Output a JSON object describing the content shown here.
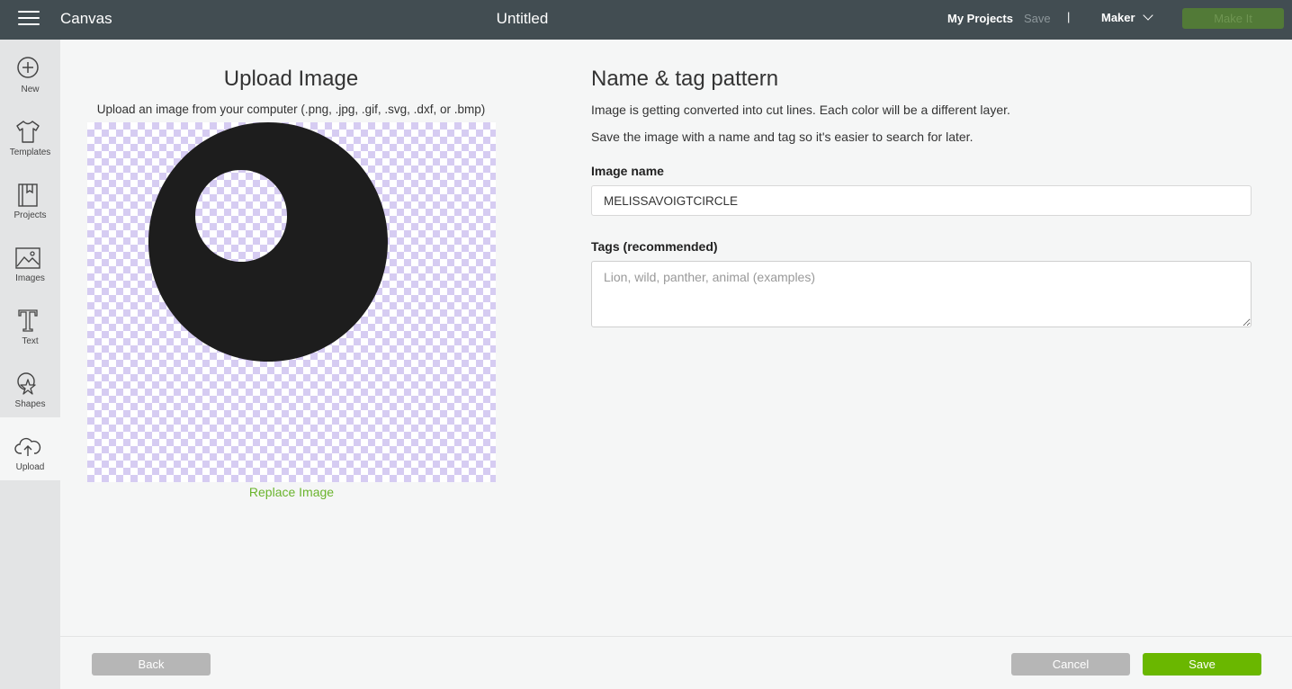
{
  "header": {
    "app_name": "Canvas",
    "doc_title": "Untitled",
    "my_projects": "My Projects",
    "save": "Save",
    "separator": "|",
    "machine": "Maker",
    "make_it": "Make It"
  },
  "sidebar": {
    "items": [
      {
        "label": "New",
        "icon": "plus-circle-icon"
      },
      {
        "label": "Templates",
        "icon": "tshirt-icon"
      },
      {
        "label": "Projects",
        "icon": "notebook-icon"
      },
      {
        "label": "Images",
        "icon": "image-icon"
      },
      {
        "label": "Text",
        "icon": "text-t-icon"
      },
      {
        "label": "Shapes",
        "icon": "shapes-icon"
      },
      {
        "label": "Upload",
        "icon": "cloud-upload-icon",
        "active": true
      }
    ]
  },
  "upload": {
    "title": "Upload Image",
    "description": "Upload an image from your computer (.png, .jpg, .gif, .svg, .dxf, or .bmp)",
    "replace_link": "Replace Image"
  },
  "pattern": {
    "title": "Name & tag pattern",
    "info_line1": "Image is getting converted into cut lines. Each color will be a different layer.",
    "info_line2": "Save the image with a name and tag so it's easier to search for later.",
    "name_label": "Image name",
    "name_value": "MELISSAVOIGTCIRCLE",
    "tags_label": "Tags (recommended)",
    "tags_placeholder": "Lion, wild, panther, animal (examples)"
  },
  "footer": {
    "back": "Back",
    "cancel": "Cancel",
    "save": "Save"
  },
  "colors": {
    "topbar": "#424d52",
    "accent_green": "#6ab700",
    "checker": "#d6ccf2",
    "shape_fill": "#1d1d1d"
  }
}
